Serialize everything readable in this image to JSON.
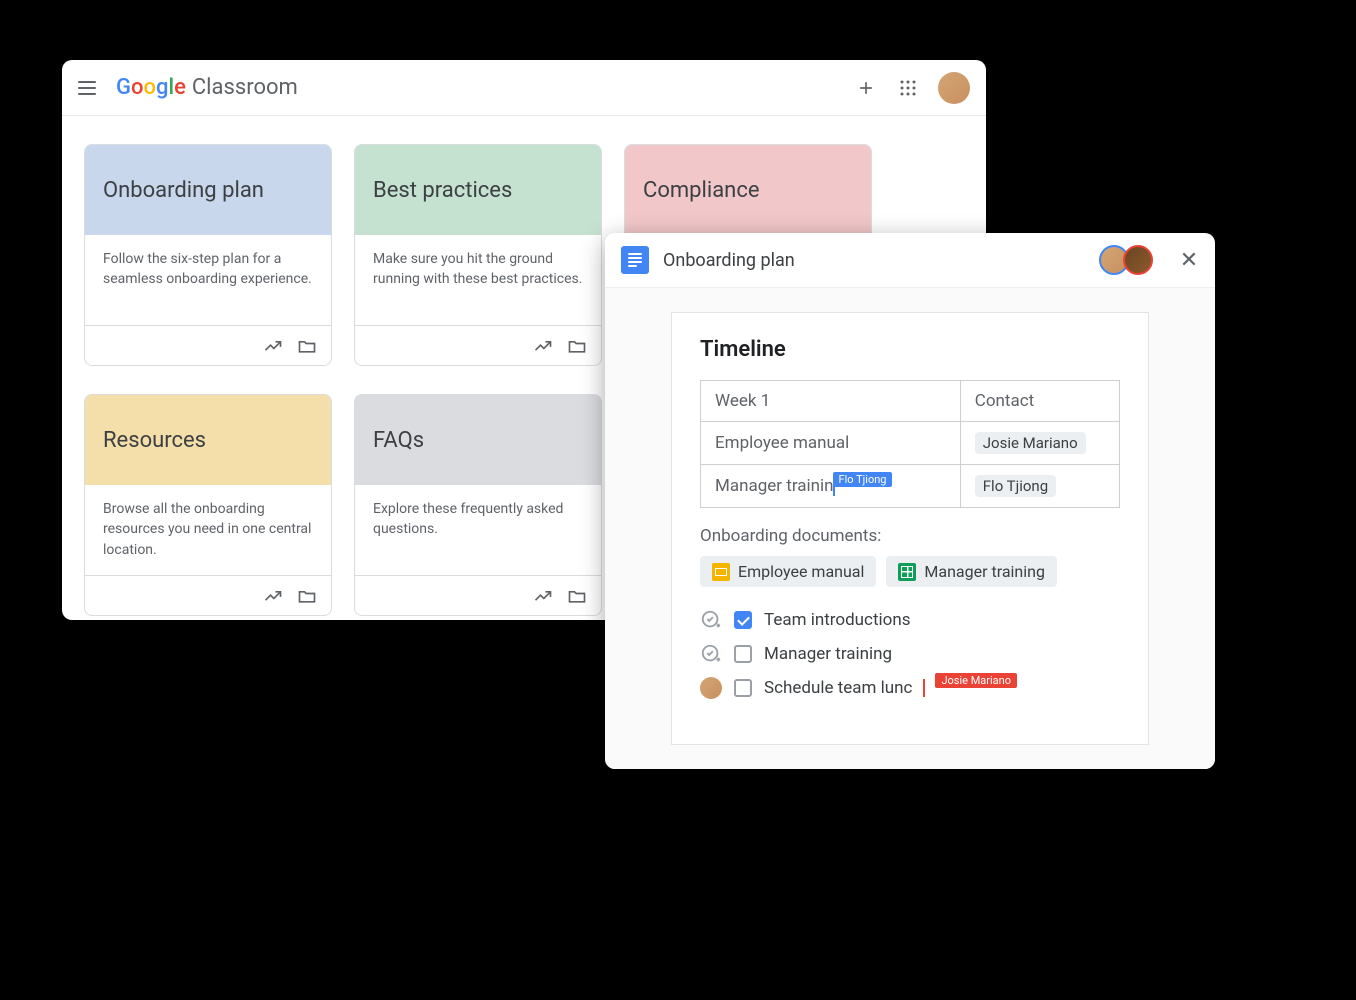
{
  "classroom": {
    "app_name": "Classroom",
    "logo_word": "Google",
    "cards": [
      {
        "title": "Onboarding plan",
        "desc": "Follow the six-step plan for a seamless onboarding experience.",
        "color": "blue"
      },
      {
        "title": "Best practices",
        "desc": "Make sure you hit the ground running with these best practices.",
        "color": "green"
      },
      {
        "title": "Compliance",
        "desc": "",
        "color": "pink"
      },
      {
        "title": "Resources",
        "desc": "Browse all the onboarding resources you need in one central location.",
        "color": "yellow"
      },
      {
        "title": "FAQs",
        "desc": "Explore these frequently asked questions.",
        "color": "gray"
      }
    ]
  },
  "docs": {
    "title": "Onboarding plan",
    "heading": "Timeline",
    "table": {
      "col1_header": "Week 1",
      "col2_header": "Contact",
      "rows": [
        {
          "task": "Employee manual",
          "contact": "Josie Mariano"
        },
        {
          "task": "Manager trainin",
          "contact": "Flo Tjiong",
          "cursor_user": "Flo Tjiong",
          "cursor_color": "blue"
        }
      ]
    },
    "section_label": "Onboarding documents:",
    "doc_chips": [
      {
        "label": "Employee manual",
        "type": "slides"
      },
      {
        "label": "Manager training",
        "type": "sheets"
      }
    ],
    "checklist": [
      {
        "label": "Team introductions",
        "checked": true,
        "icon": "add-check"
      },
      {
        "label": "Manager training",
        "checked": false,
        "icon": "add-check"
      },
      {
        "label": "Schedule team lunc",
        "checked": false,
        "icon": "avatar",
        "cursor_user": "Josie Mariano",
        "cursor_color": "red"
      }
    ]
  }
}
